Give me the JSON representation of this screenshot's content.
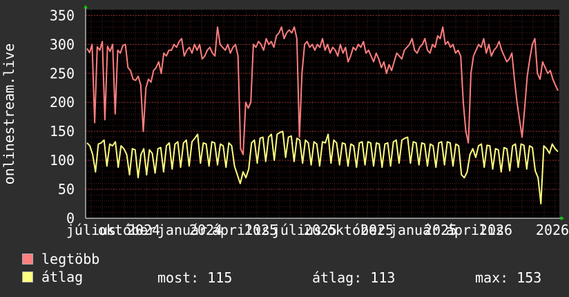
{
  "chart_data": {
    "type": "line",
    "ylabel": "onlinestream.live",
    "ylim": [
      0,
      360
    ],
    "yticks": [
      0,
      50,
      100,
      150,
      200,
      250,
      300,
      350
    ],
    "xtick_labels": [
      "július",
      "október",
      "2024",
      "január",
      "2024",
      "április",
      "2025",
      "július",
      "2025",
      "október",
      "2025",
      "január",
      "2025",
      "április",
      "2026",
      "2026"
    ],
    "grid": true,
    "legend_placement": "bottom-left",
    "series": [
      {
        "name": "legtöbb",
        "color": "#ff7f7f",
        "values": [
          293,
          286,
          300,
          165,
          296,
          290,
          305,
          170,
          297,
          288,
          300,
          180,
          290,
          285,
          298,
          300,
          260,
          255,
          240,
          238,
          245,
          230,
          150,
          225,
          240,
          235,
          255,
          260,
          270,
          250,
          285,
          280,
          290,
          290,
          300,
          295,
          305,
          310,
          280,
          290,
          295,
          285,
          300,
          290,
          300,
          275,
          280,
          290,
          295,
          285,
          280,
          330,
          300,
          295,
          290,
          300,
          285,
          295,
          300,
          280,
          120,
          110,
          200,
          190,
          200,
          300,
          295,
          305,
          300,
          290,
          310,
          300,
          305,
          295,
          315,
          320,
          330,
          310,
          320,
          325,
          320,
          330,
          310,
          140,
          250,
          300,
          305,
          295,
          300,
          290,
          300,
          295,
          310,
          290,
          300,
          285,
          295,
          290,
          280,
          300,
          285,
          295,
          270,
          280,
          295,
          290,
          300,
          295,
          305,
          285,
          290,
          280,
          270,
          285,
          275,
          260,
          270,
          250,
          265,
          255,
          270,
          285,
          280,
          275,
          290,
          295,
          300,
          310,
          290,
          285,
          295,
          300,
          310,
          290,
          285,
          300,
          295,
          315,
          310,
          330,
          300,
          305,
          295,
          300,
          285,
          290,
          280,
          200,
          150,
          130,
          250,
          280,
          290,
          300,
          295,
          310,
          285,
          300,
          280,
          290,
          295,
          305,
          290,
          280,
          270,
          275,
          285,
          240,
          200,
          170,
          140,
          190,
          245,
          275,
          300,
          310,
          250,
          240,
          270,
          260,
          250,
          255,
          240,
          230,
          220
        ]
      },
      {
        "name": "átlag",
        "color": "#ffff80",
        "values": [
          130,
          125,
          110,
          80,
          128,
          130,
          135,
          90,
          128,
          125,
          132,
          88,
          125,
          120,
          110,
          75,
          120,
          118,
          70,
          110,
          120,
          75,
          118,
          112,
          78,
          120,
          122,
          80,
          125,
          130,
          85,
          128,
          132,
          88,
          130,
          135,
          90,
          132,
          138,
          145,
          95,
          130,
          128,
          90,
          132,
          130,
          92,
          128,
          125,
          88,
          130,
          125,
          90,
          75,
          60,
          80,
          70,
          85,
          130,
          135,
          95,
          138,
          140,
          98,
          140,
          145,
          100,
          145,
          148,
          150,
          105,
          140,
          142,
          98,
          138,
          135,
          95,
          135,
          130,
          92,
          132,
          128,
          90,
          132,
          130,
          145,
          95,
          135,
          130,
          92,
          130,
          128,
          90,
          128,
          125,
          88,
          130,
          132,
          92,
          132,
          130,
          90,
          130,
          128,
          88,
          128,
          130,
          90,
          132,
          135,
          95,
          135,
          138,
          140,
          95,
          132,
          130,
          92,
          130,
          128,
          90,
          128,
          125,
          88,
          130,
          132,
          92,
          132,
          130,
          90,
          128,
          125,
          75,
          70,
          80,
          110,
          120,
          105,
          125,
          128,
          88,
          126,
          125,
          85,
          120,
          118,
          80,
          122,
          120,
          82,
          125,
          128,
          88,
          128,
          126,
          85,
          125,
          122,
          82,
          70,
          25,
          125,
          120,
          112,
          128,
          120,
          115
        ]
      }
    ]
  },
  "legend": {
    "items": [
      {
        "label": "legtöbb",
        "color": "#ff7f7f"
      },
      {
        "label": "átlag",
        "color": "#ffff80"
      }
    ]
  },
  "stats": {
    "now": "most: 115",
    "avg": "átlag: 113",
    "max": "max: 153"
  },
  "colors": {
    "background": "#2e2e2e",
    "plot_background": "#000000",
    "grid": "#7a2a2a",
    "text": "#ffffff",
    "axis_arrow": "#00cc00"
  }
}
